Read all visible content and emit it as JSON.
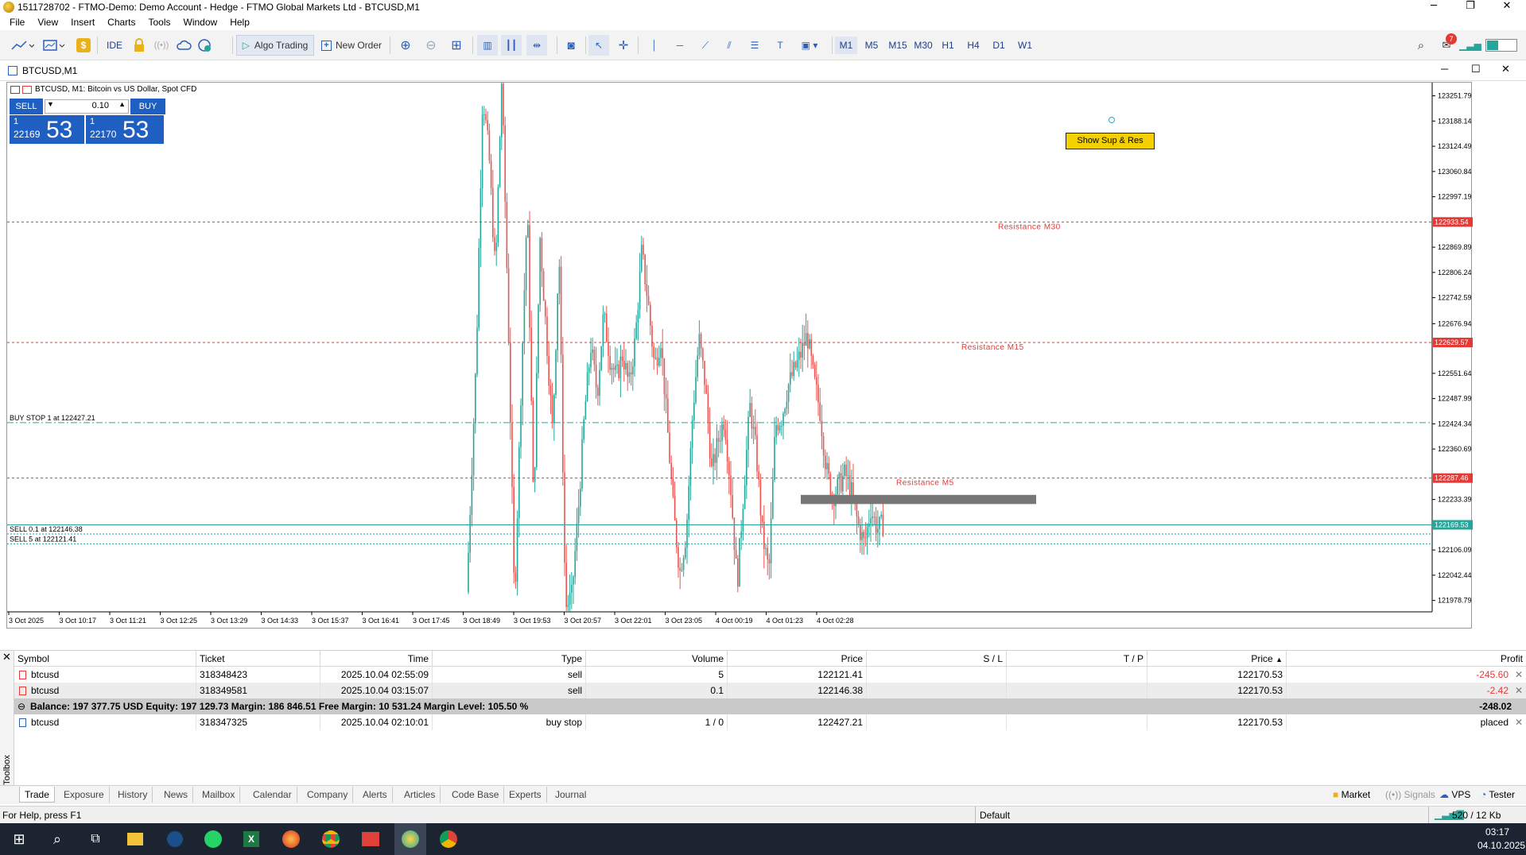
{
  "window": {
    "title": "1511728702 - FTMO-Demo: Demo Account - Hedge - FTMO Global Markets Ltd - BTCUSD,M1"
  },
  "menu": [
    "File",
    "View",
    "Insert",
    "Charts",
    "Tools",
    "Window",
    "Help"
  ],
  "toolbar": {
    "ide": "IDE",
    "algo_trading": "Algo Trading",
    "new_order": "New Order",
    "timeframes": [
      "M1",
      "M5",
      "M15",
      "M30",
      "H1",
      "H4",
      "D1",
      "W1"
    ],
    "active_timeframe": "M1",
    "notification_count": "7"
  },
  "chart_window": {
    "title": "BTCUSD,M1",
    "subtitle": "BTCUSD, M1:  Bitcoin vs US Dollar, Spot CFD"
  },
  "one_click": {
    "sell": "SELL",
    "buy": "BUY",
    "volume": "0.10",
    "sell_big": "1",
    "sell_price": "22169",
    "sell_pips": "53",
    "buy_big": "1",
    "buy_price": "22170",
    "buy_pips": "53"
  },
  "show_button": "Show Sup & Res",
  "chart_data": {
    "type": "candlestick",
    "symbol": "BTCUSD",
    "timeframe": "M1",
    "ylim": [
      121950,
      123285
    ],
    "y_ticks": [
      "123251.79",
      "123188.14",
      "123124.49",
      "123060.84",
      "122997.19",
      "122869.89",
      "122806.24",
      "122742.59",
      "122676.94",
      "122551.64",
      "122487.99",
      "122424.34",
      "122360.69",
      "122233.39",
      "122106.09",
      "122042.44",
      "121978.79"
    ],
    "x_ticks": [
      "3 Oct 2025",
      "3 Oct 10:17",
      "3 Oct 11:21",
      "3 Oct 12:25",
      "3 Oct 13:29",
      "3 Oct 14:33",
      "3 Oct 15:37",
      "3 Oct 16:41",
      "3 Oct 17:45",
      "3 Oct 18:49",
      "3 Oct 19:53",
      "3 Oct 20:57",
      "3 Oct 22:01",
      "3 Oct 23:05",
      "4 Oct 00:19",
      "4 Oct 01:23",
      "4 Oct 02:28"
    ],
    "colors": {
      "up": "#26a69a",
      "down": "#ef5350",
      "resistance": "#e53935",
      "pending": "#26a69a",
      "bid": "#26a69a"
    },
    "lines": [
      {
        "label": "Resistance M30",
        "price": 122933.54,
        "price_label": "122933.54",
        "style": "dotted"
      },
      {
        "label": "Resistance M15",
        "price": 122629.57,
        "price_label": "122629.57",
        "style": "dotted"
      },
      {
        "label": "Resistance M5",
        "price": 122287.46,
        "price_label": "122287.46",
        "style": "dotted"
      },
      {
        "label": "BUY STOP 1 at 122427.21",
        "price": 122427.21,
        "style": "dashdot"
      },
      {
        "label": "SELL 0.1 at 122146.38",
        "price": 122146.38,
        "style": "dotted"
      },
      {
        "label": "SELL 5 at 122121.41",
        "price": 122121.41,
        "style": "dotted"
      }
    ],
    "bid": {
      "price": 122169.53,
      "label": "122169.53"
    },
    "zone": {
      "from_price": 122245,
      "to_price": 122222
    }
  },
  "terminal": {
    "headers": [
      "Symbol",
      "Ticket",
      "Time",
      "Type",
      "Volume",
      "Price",
      "S / L",
      "T / P",
      "Price",
      "Profit"
    ],
    "rows": [
      {
        "symbol": "btcusd",
        "ticket": "318348423",
        "time": "2025.10.04 02:55:09",
        "type": "sell",
        "volume": "5",
        "price": "122121.41",
        "sl": "",
        "tp": "",
        "cur": "122170.53",
        "profit": "-245.60"
      },
      {
        "symbol": "btcusd",
        "ticket": "318349581",
        "time": "2025.10.04 03:15:07",
        "type": "sell",
        "volume": "0.1",
        "price": "122146.38",
        "sl": "",
        "tp": "",
        "cur": "122170.53",
        "profit": "-2.42"
      }
    ],
    "balance_line": "Balance: 197 377.75 USD  Equity: 197 129.73  Margin: 186 846.51  Free Margin: 10 531.24  Margin Level: 105.50 %",
    "balance_total": "-248.02",
    "order": {
      "symbol": "btcusd",
      "ticket": "318347325",
      "time": "2025.10.04 02:10:01",
      "type": "buy stop",
      "volume": "1 / 0",
      "price": "122427.21",
      "cur": "122170.53",
      "state": "placed"
    },
    "toolbox_label": "Toolbox"
  },
  "tabs": [
    "Trade",
    "Exposure",
    "History",
    "News",
    "Mailbox",
    "Calendar",
    "Company",
    "Alerts",
    "Articles",
    "Code Base",
    "Experts",
    "Journal"
  ],
  "right_tabs": [
    "Market",
    "Signals",
    "VPS",
    "Tester"
  ],
  "status": {
    "help": "For Help, press F1",
    "profile": "Default",
    "traffic": "520 / 12 Kb"
  },
  "taskbar": {
    "time": "03:17",
    "date": "04.10.2025"
  }
}
